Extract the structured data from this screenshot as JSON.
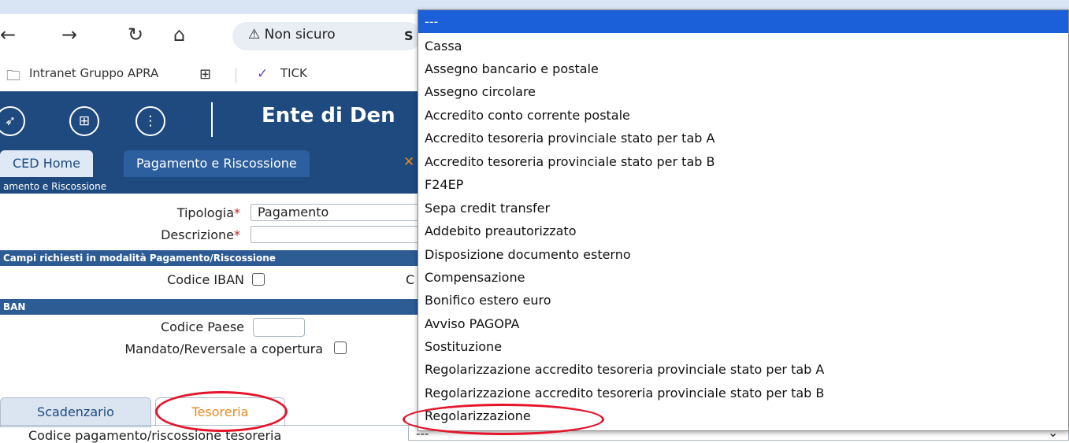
{
  "browser": {
    "security_label": "Non sicuro",
    "url_fragment": "S",
    "bookmarks": [
      "Intranet Gruppo APRA",
      "TICK"
    ]
  },
  "app": {
    "title": "Ente di Den",
    "tabs": [
      {
        "label": "CED Home"
      },
      {
        "label": "Pagamento e Riscossione"
      }
    ],
    "close_symbol": "✕",
    "section_title": "amento e Riscossione"
  },
  "form": {
    "tipologia": {
      "label": "Tipologia",
      "value": "Pagamento"
    },
    "descrizione": {
      "label": "Descrizione",
      "value": ""
    },
    "required_mark": "*",
    "campi_header": "Campi richiesti in modalità Pagamento/Riscossione",
    "codice_iban_label": "Codice IBAN",
    "truncated_c": "C",
    "iban_header": "BAN",
    "codice_paese_label": "Codice Paese",
    "codice_paese_value": "",
    "mandato_label": "Mandato/Reversale a copertura"
  },
  "bottom_tabs": [
    {
      "label": "Scadenzario"
    },
    {
      "label": "Tesoreria"
    }
  ],
  "codice_pagamento": {
    "label": "Codice pagamento/riscossione tesoreria",
    "value": "---"
  },
  "dropdown": {
    "selected_index": 0,
    "options": [
      "---",
      "Cassa",
      "Assegno bancario e postale",
      "Assegno circolare",
      "Accredito conto corrente postale",
      "Accredito tesoreria provinciale stato per tab A",
      "Accredito tesoreria provinciale stato per tab B",
      "F24EP",
      "Sepa credit transfer",
      "Addebito preautorizzato",
      "Disposizione documento esterno",
      "Compensazione",
      "Bonifico estero euro",
      "Avviso PAGOPA",
      "Sostituzione",
      "Regolarizzazione accredito tesoreria provinciale stato per tab A",
      "Regolarizzazione accredito tesoreria provinciale stato per tab B",
      "Regolarizzazione"
    ]
  },
  "colors": {
    "app_header": "#1e4a80",
    "accent_orange": "#e8871e",
    "selection_blue": "#1b5fd9",
    "annotation_red": "#e5142b"
  }
}
